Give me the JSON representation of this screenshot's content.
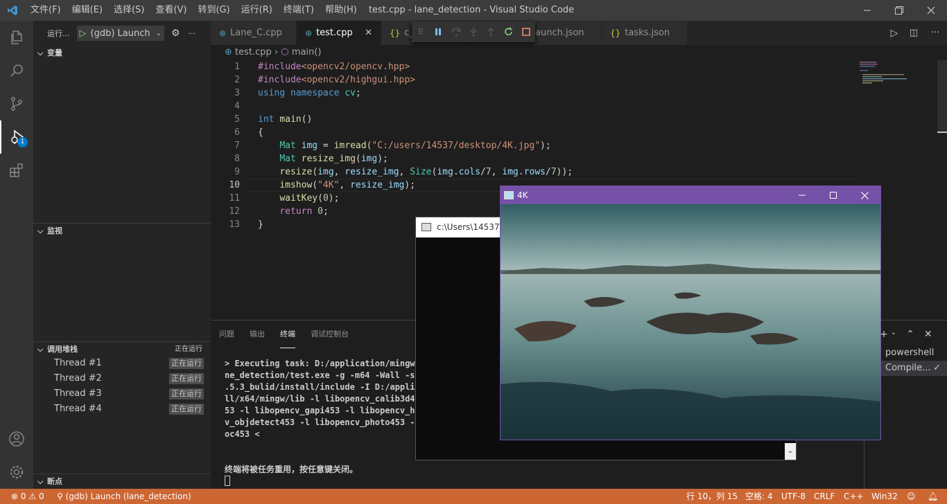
{
  "titlebar": {
    "menus": [
      "文件(F)",
      "编辑(E)",
      "选择(S)",
      "查看(V)",
      "转到(G)",
      "运行(R)",
      "终端(T)",
      "帮助(H)"
    ],
    "title": "test.cpp - lane_detection - Visual Studio Code"
  },
  "activity": {
    "debug_badge": "1"
  },
  "sidebar": {
    "run_label": "运行...",
    "launch_config": "(gdb) Launch",
    "variables_title": "变量",
    "watch_title": "监视",
    "callstack_title": "调用堆栈",
    "callstack_status": "正在运行",
    "threads": [
      {
        "name": "Thread #1",
        "status": "正在运行"
      },
      {
        "name": "Thread #2",
        "status": "正在运行"
      },
      {
        "name": "Thread #3",
        "status": "正在运行"
      },
      {
        "name": "Thread #4",
        "status": "正在运行"
      }
    ],
    "breakpoints_title": "断点"
  },
  "tabs": [
    {
      "label": "Lane_C.cpp",
      "icon": "C++"
    },
    {
      "label": "test.cpp",
      "icon": "C++",
      "active": true
    },
    {
      "label": "c_",
      "icon": "{}"
    },
    {
      "label": "launch.json",
      "icon": "{}"
    },
    {
      "label": "tasks.json",
      "icon": "{}"
    }
  ],
  "tab_partial_launch": "aunch.json",
  "breadcrumb": {
    "file": "test.cpp",
    "symbol": "main()"
  },
  "editor": {
    "line_numbers": [
      "1",
      "2",
      "3",
      "4",
      "5",
      "6",
      "7",
      "8",
      "9",
      "10",
      "11",
      "12",
      "13"
    ],
    "current_line": "10"
  },
  "panel": {
    "tabs": [
      "问题",
      "输出",
      "终端",
      "调试控制台"
    ],
    "active_tab": "终端",
    "terminal_lines": [
      "> Executing task: D:/application/mingw64",
      "ne_detection/test.exe -g -m64 -Wall -sta",
      ".5.3_bulid/install/include -I D:/applica",
      "ll/x64/mingw/lib -l libopencv_calib3d453",
      "53 -l libopencv_gapi453 -l libopencv_hig",
      "v_objdetect453 -l libopencv_photo453 -l",
      "oc453 <"
    ],
    "terminal_reuse_msg": "终端将被任务重用，按任意键关闭。",
    "term_list": [
      "powershell",
      "Compile..."
    ]
  },
  "console_window": {
    "title": "c:\\Users\\14537\\"
  },
  "image_window": {
    "title": "4K"
  },
  "statusbar": {
    "errors": "0",
    "warnings": "0",
    "debug_target": "(gdb) Launch (lane_detection)",
    "position": "行 10，列 15",
    "spaces": "空格: 4",
    "encoding": "UTF-8",
    "eol": "CRLF",
    "language": "C++",
    "platform": "Win32"
  },
  "colors": {
    "statusbar": "#cc6633",
    "accent": "#007acc",
    "cv_title": "#7651a8"
  }
}
